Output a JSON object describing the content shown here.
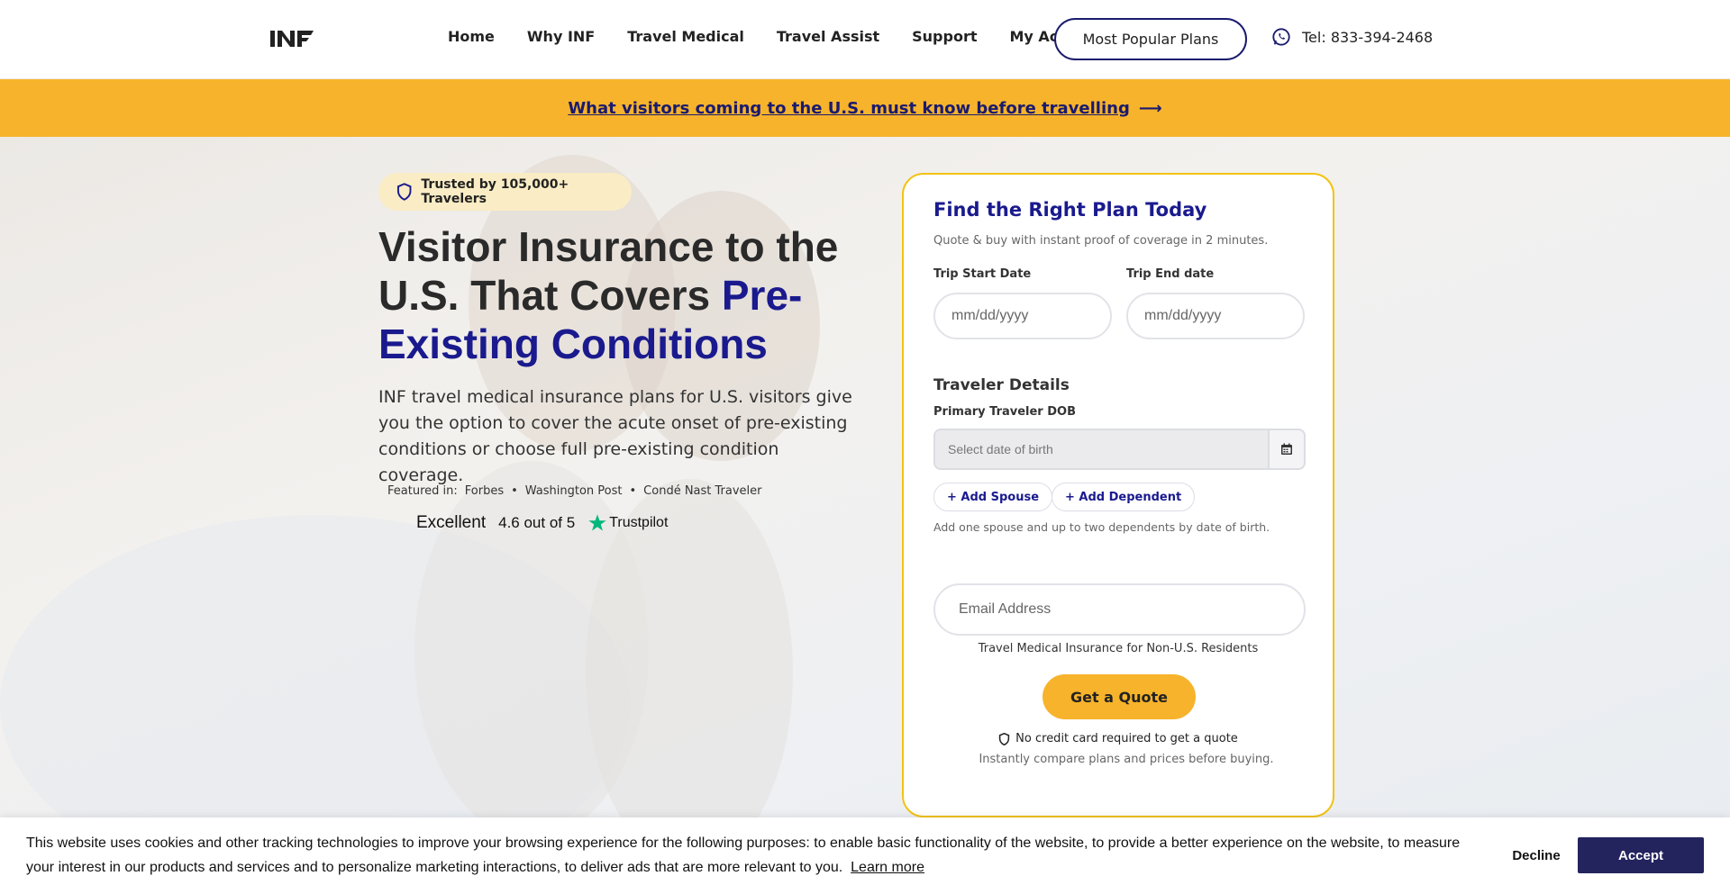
{
  "header": {
    "logo_text": "INF",
    "nav": [
      "Home",
      "Why INF",
      "Travel Medical",
      "Travel Assist",
      "Support",
      "My Account"
    ],
    "popular_button": "Most Popular Plans",
    "phone": "Tel: 833-394-2468"
  },
  "banner": {
    "text": "What visitors coming to the U.S. must know before travelling",
    "arrow": "⟶"
  },
  "hero": {
    "badge": "Trusted by 105,000+ Travelers",
    "headline_plain": "Visitor Insurance to the U.S. That Covers ",
    "headline_accent": "Pre-Existing Conditions",
    "subtext": "INF travel medical insurance plans for U.S. visitors give you the option to cover the acute onset of pre-existing conditions or choose full pre-existing condition coverage.",
    "featured_label": "Featured in:",
    "featured": [
      "Forbes",
      "Washington Post",
      "Condé Nast Traveler"
    ],
    "featured_sep": "•",
    "trustpilot": {
      "rating_word": "Excellent",
      "rating": "4.6 out of 5",
      "brand": "Trustpilot"
    }
  },
  "quote_form": {
    "title": "Find the Right Plan Today",
    "subtitle": "Quote & buy with instant proof of coverage in 2 minutes.",
    "start_label": "Trip Start Date",
    "start_placeholder": "mm/dd/yyyy",
    "end_label": "Trip End date",
    "end_placeholder": "mm/dd/yyyy",
    "traveler_section": "Traveler Details",
    "dob_label": "Primary Traveler DOB",
    "dob_placeholder": "Select date of birth",
    "add_spouse": "+ Add Spouse",
    "add_dependent": "+ Add Dependent",
    "hint": "Add one spouse and up to two dependents by date of birth.",
    "email_placeholder": "Email Address",
    "tmi_label": "Travel Medical Insurance for Non-U.S. Residents",
    "quote_button": "Get a Quote",
    "no_cc": "No credit card required to get a quote",
    "compare": "Instantly compare plans and prices before buying."
  },
  "cookie": {
    "text": "This website uses cookies and other tracking technologies to improve your browsing experience for the following purposes: to enable basic functionality of the website, to provide a better experience on the website, to measure your interest in our products and services and to personalize marketing interactions, to deliver ads that are more relevant to you.",
    "learn_more": "Learn more",
    "decline": "Decline",
    "accept": "Accept"
  },
  "colors": {
    "brand_navy": "#1a1a8e",
    "banner_yellow": "#f7b32b",
    "card_border": "#f2c313",
    "accept_bg": "#23235e",
    "trustpilot_green": "#00b67a"
  }
}
